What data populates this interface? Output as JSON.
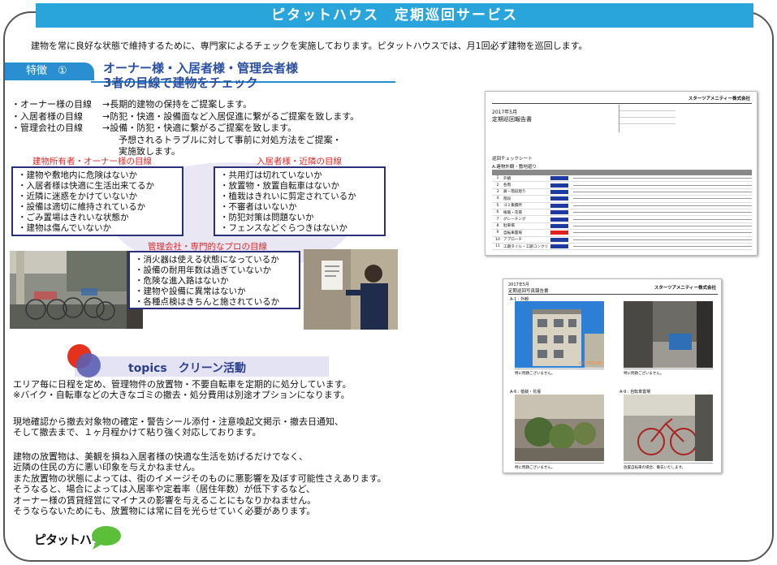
{
  "header": {
    "title": "ピタットハウス　定期巡回サービス"
  },
  "intro": "建物を常に良好な状態で維持するために、専門家によるチェックを実施しております。ピタットハウスでは、月1回必ず建物を巡回します。",
  "feature": {
    "badge": "特徴　①",
    "heading_line1": "オーナー様・入居者様・管理会者様",
    "heading_line2": "3者の目線で建物をチェック",
    "goals": [
      {
        "label": "・オーナー様の目線",
        "text": "→長期的建物の保持をご提案します。"
      },
      {
        "label": "・入居者様の目線",
        "text": "→防犯・快適・設備面など入居促進に繋がるご提案を致します。"
      },
      {
        "label": "・管理会社の目線",
        "text": "→設備・防犯・快適に繋がるご提案を致します。"
      }
    ],
    "goals_extra_1": "予想されるトラブルに対して事前に対処方法をご提案・",
    "goals_extra_2": "実施致します。"
  },
  "groups": {
    "owner": {
      "label": "建物所有者・オーナー様の目線",
      "items": [
        "・建物や敷地内に危険はないか",
        "・入居者様は快適に生活出来てるか",
        "・近隣に迷惑をかけていないか",
        "・設備は適切に維持されているか",
        "・ごみ置場はきれいな状態か",
        "・建物は傷んでいないか"
      ]
    },
    "tenant": {
      "label": "入居者様・近隣の目線",
      "items": [
        "・共用灯は切れていないか",
        "・放置物・放置自転車はないか",
        "・植栽はきれいに剪定されているか",
        "・不審者はいないか",
        "・防犯対策は問題ないか",
        "・フェンスなどぐらつきはないか"
      ]
    },
    "manager": {
      "label": "管理会社・専門的なプロの目線",
      "items": [
        "・消火器は使える状態になっているか",
        "・設備の耐用年数は過ぎていないか",
        "・危険な進入路はないか",
        "・建物や設備に異常はないか",
        "・各種点検はきちんと施されているか"
      ]
    }
  },
  "report1": {
    "company": "スターツアメニティー株式会社",
    "date": "2017年5月",
    "title": "定期巡回報告書",
    "section": "巡回チェックシート",
    "sub": "A.建物外観・敷地廻り",
    "rows": [
      {
        "no": "1",
        "item": "外観"
      },
      {
        "no": "2",
        "item": "各階"
      },
      {
        "no": "3",
        "item": "廊・階段廻り"
      },
      {
        "no": "4",
        "item": "階段"
      },
      {
        "no": "5",
        "item": "ゴミ集積所"
      },
      {
        "no": "6",
        "item": "植栽・花壇"
      },
      {
        "no": "7",
        "item": "グレーチング"
      },
      {
        "no": "8",
        "item": "駐車場"
      },
      {
        "no": "9",
        "item": "自転車置場"
      },
      {
        "no": "10",
        "item": "アプローチ"
      },
      {
        "no": "11",
        "item": "工期タイル・工期コンクリ"
      }
    ]
  },
  "report2": {
    "company": "スターツアメニティー株式会社",
    "date": "2017年5月",
    "title": "定期巡回写真報告書",
    "captions": [
      "A-1 : 外観",
      "A-6 : 植栽・花壇",
      "A-9 : 自転車置場"
    ],
    "stamp": "2017/05/10",
    "notes": [
      "特に問題ございません。",
      "特に問題ございません。",
      "特に問題ございません。",
      "放置自転車の場合、撤去いたします。"
    ]
  },
  "topics": {
    "title": "topics　クリーン活動",
    "paragraphs": [
      [
        "エリア毎に日程を定め、管理物件の放置物・不要自転車を定期的に処分しています。",
        "※バイク・自転車などの大きなゴミの撤去・処分費用は別途オプションになります。"
      ],
      [
        "現地確認から撤去対象物の確定・警告シール添付・注意喚起文掲示・撤去日通知、",
        "そして撤去まで、１ヶ月程かけて粘り強く対応しております。"
      ],
      [
        "建物の放置物は、美観を損ね入居者様の快適な生活を妨げるだけでなく、",
        "近隣の住民の方に悪い印象を与えかねません。",
        "また放置物の状態によっては、街のイメージそのものに悪影響を及ぼす可能性さえあります。",
        "そうなると、場合によっては入居率や定着率（居住年数）が低下するなど、",
        "オーナー様の賃貸経営にマイナスの影響を与えることにもなりかねません。",
        "そうならないためにも、放置物には常に目を光らせていく必要があります。"
      ]
    ]
  },
  "logo": {
    "text": "ピタットハウス"
  },
  "colors": {
    "title_bar": "#2aa5dc",
    "heading_blue": "#2a4ea0",
    "group_red": "#e0292a",
    "box_border": "#2b2f7a",
    "logo_green": "#5bbf3a"
  }
}
